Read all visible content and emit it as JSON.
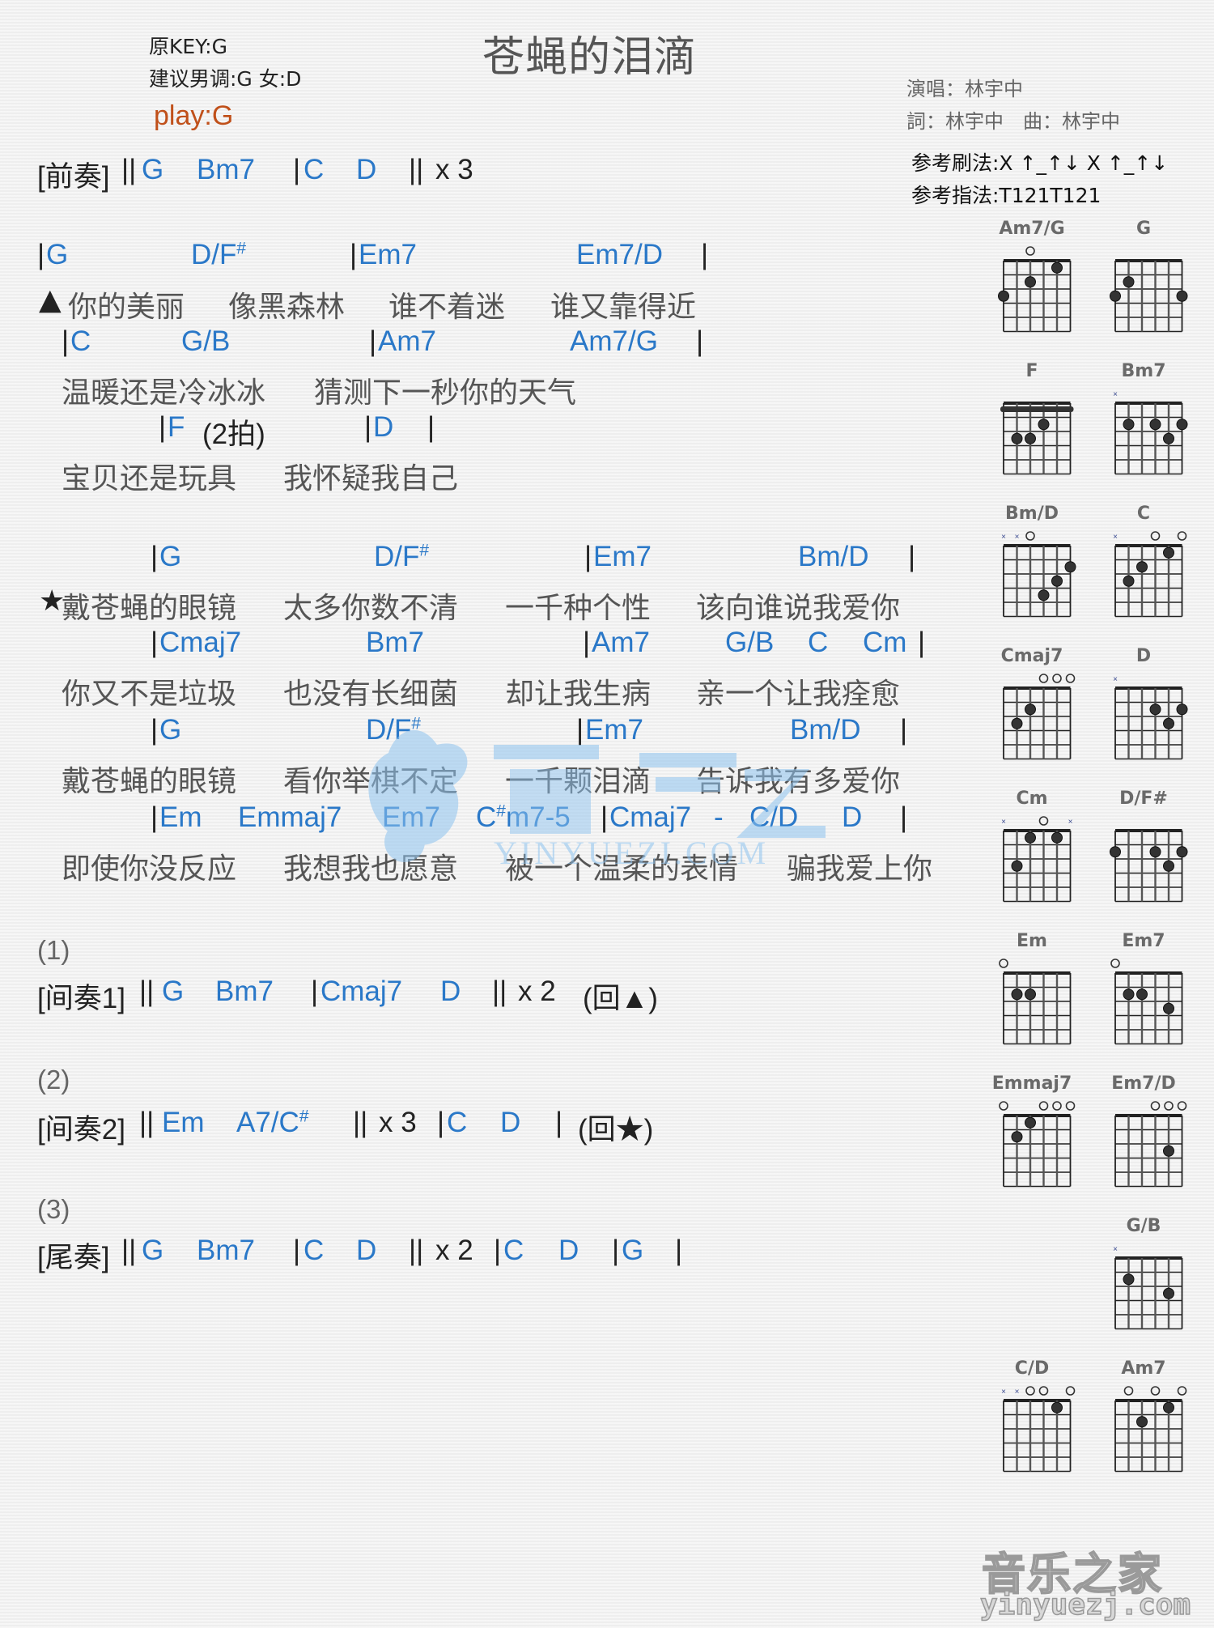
{
  "header": {
    "title": "苍蝇的泪滴",
    "original_key": "原KEY:G",
    "suggested_key": "建议男调:G 女:D",
    "play_key": "play:G",
    "singer": "演唱：林宇中",
    "writers": "詞：林宇中　曲：林宇中",
    "strum_pattern": "参考刷法:X ↑_↑↓ X ↑_↑↓",
    "finger_pattern": "参考指法:T121T121"
  },
  "colors": {
    "chord": "#2a78c8",
    "lyric": "#555555",
    "play_key": "#c0501a",
    "watermark": "#8ec3ef"
  },
  "intro": {
    "label": "[前奏]",
    "tokens": [
      "||",
      "G",
      "Bm7",
      "|",
      "C",
      "D",
      "||",
      "x 3"
    ]
  },
  "verse": [
    {
      "chords": [
        [
          "|",
          "G"
        ],
        [
          "",
          "D/F#"
        ],
        [
          "|",
          "Em7"
        ],
        [
          "",
          "Em7/D"
        ],
        [
          "|",
          ""
        ]
      ],
      "lyric": [
        "▲",
        "你的美丽",
        "像黑森林",
        "谁不着迷",
        "谁又靠得近"
      ]
    },
    {
      "chords": [
        [
          "|",
          "C"
        ],
        [
          "",
          "G/B"
        ],
        [
          "|",
          "Am7"
        ],
        [
          "",
          "Am7/G"
        ],
        [
          "|",
          ""
        ]
      ],
      "lyric": [
        "",
        "温暖还是冷冰冰",
        "猜测下一秒你的天气"
      ]
    },
    {
      "chords": [
        [
          "|",
          "F"
        ],
        [
          "",
          "(2拍)"
        ],
        [
          "|",
          "D"
        ],
        [
          "|",
          ""
        ]
      ],
      "lyric": [
        "",
        "宝贝还是玩具",
        "我怀疑我自己"
      ]
    }
  ],
  "chorus": [
    {
      "chords": [
        [
          "|",
          "G"
        ],
        [
          "",
          "D/F#"
        ],
        [
          "|",
          "Em7"
        ],
        [
          "",
          "Bm/D"
        ],
        [
          "|",
          ""
        ]
      ],
      "lyric": [
        "★",
        "戴苍蝇的眼镜",
        "太多你数不清",
        "一千种个性",
        "该向谁说我爱你"
      ]
    },
    {
      "chords": [
        [
          "|",
          "Cmaj7"
        ],
        [
          "",
          "Bm7"
        ],
        [
          "|",
          "Am7"
        ],
        [
          "",
          "G/B"
        ],
        [
          "",
          "C"
        ],
        [
          "",
          "Cm"
        ],
        [
          "|",
          ""
        ]
      ],
      "lyric": [
        "",
        "你又不是垃圾",
        "也没有长细菌",
        "却让我生病",
        "亲一个让我痊愈"
      ]
    },
    {
      "chords": [
        [
          "|",
          "G"
        ],
        [
          "",
          "D/F#"
        ],
        [
          "|",
          "Em7"
        ],
        [
          "",
          "Bm/D"
        ],
        [
          "|",
          ""
        ]
      ],
      "lyric": [
        "",
        "戴苍蝇的眼镜",
        "看你举棋不定",
        "一千颗泪滴",
        "告诉我有多爱你"
      ]
    },
    {
      "chords": [
        [
          "|",
          "Em"
        ],
        [
          "",
          "Emmaj7"
        ],
        [
          "",
          "Em7"
        ],
        [
          "",
          "C#m7-5"
        ],
        [
          "|",
          "Cmaj7"
        ],
        [
          "",
          "-"
        ],
        [
          "",
          "C/D"
        ],
        [
          "",
          "D"
        ],
        [
          "|",
          ""
        ]
      ],
      "lyric": [
        "",
        "即使你没反应",
        "我想我也愿意",
        "被一个温柔的表情",
        "骗我爱上你"
      ]
    }
  ],
  "interludes": [
    {
      "number": "(1)",
      "label": "[间奏1]",
      "tokens": [
        "||",
        "G",
        "Bm7",
        "|",
        "Cmaj7",
        "D",
        "||",
        "x 2",
        "(回▲)"
      ]
    },
    {
      "number": "(2)",
      "label": "[间奏2]",
      "tokens": [
        "||",
        "Em",
        "A7/C#",
        "||",
        "x 3",
        "|",
        "C",
        "D",
        "|",
        "(回★)"
      ]
    },
    {
      "number": "(3)",
      "label": "[尾奏]",
      "tokens": [
        "||",
        "G",
        "Bm7",
        "|",
        "C",
        "D",
        "||",
        "x 2",
        "|",
        "C",
        "D",
        "|",
        "G",
        "|"
      ]
    }
  ],
  "chord_diagrams": [
    {
      "name": "Am7/G",
      "top": [
        null,
        null,
        0,
        null,
        null,
        null
      ],
      "dots": [
        [
          6,
          3
        ],
        [
          4,
          2
        ],
        [
          2,
          1
        ]
      ],
      "barre": null
    },
    {
      "name": "G",
      "top": [
        null,
        null,
        null,
        null,
        null,
        null
      ],
      "dots": [
        [
          6,
          3
        ],
        [
          5,
          2
        ],
        [
          1,
          3
        ]
      ],
      "barre": null
    },
    {
      "name": "F",
      "top": [
        null,
        null,
        null,
        null,
        null,
        null
      ],
      "dots": [
        [
          5,
          3
        ],
        [
          4,
          3
        ],
        [
          3,
          2
        ]
      ],
      "barre": 1
    },
    {
      "name": "Bm7",
      "top": [
        -1,
        null,
        null,
        null,
        null,
        null
      ],
      "dots": [
        [
          5,
          2
        ],
        [
          3,
          2
        ],
        [
          1,
          2
        ],
        [
          2,
          3
        ]
      ],
      "barre": null
    },
    {
      "name": "Bm/D",
      "top": [
        -1,
        -1,
        0,
        null,
        null,
        null
      ],
      "dots": [
        [
          1,
          2
        ],
        [
          2,
          3
        ],
        [
          3,
          4
        ]
      ],
      "barre": null
    },
    {
      "name": "C",
      "top": [
        -1,
        null,
        null,
        0,
        null,
        0
      ],
      "dots": [
        [
          2,
          1
        ],
        [
          4,
          2
        ],
        [
          5,
          3
        ]
      ],
      "barre": null
    },
    {
      "name": "Cmaj7",
      "top": [
        null,
        null,
        null,
        0,
        0,
        0
      ],
      "dots": [
        [
          4,
          2
        ],
        [
          5,
          3
        ]
      ],
      "barre": null
    },
    {
      "name": "D",
      "top": [
        -1,
        null,
        null,
        null,
        null,
        null
      ],
      "dots": [
        [
          3,
          2
        ],
        [
          1,
          2
        ],
        [
          2,
          3
        ]
      ],
      "barre": null
    },
    {
      "name": "Cm",
      "top": [
        -1,
        null,
        null,
        0,
        null,
        -1
      ],
      "dots": [
        [
          4,
          1
        ],
        [
          2,
          1
        ],
        [
          5,
          3
        ]
      ],
      "barre": null
    },
    {
      "name": "D/F#",
      "top": [
        null,
        null,
        null,
        null,
        null,
        null
      ],
      "dots": [
        [
          6,
          2
        ],
        [
          3,
          2
        ],
        [
          1,
          2
        ],
        [
          2,
          3
        ]
      ],
      "barre": null
    },
    {
      "name": "Em",
      "top": [
        0,
        null,
        null,
        null,
        null,
        null
      ],
      "dots": [
        [
          5,
          2
        ],
        [
          4,
          2
        ]
      ],
      "barre": null
    },
    {
      "name": "Em7",
      "top": [
        0,
        null,
        null,
        null,
        null,
        null
      ],
      "dots": [
        [
          5,
          2
        ],
        [
          4,
          2
        ],
        [
          2,
          3
        ]
      ],
      "barre": null
    },
    {
      "name": "Emmaj7",
      "top": [
        0,
        null,
        null,
        0,
        0,
        0
      ],
      "dots": [
        [
          4,
          1
        ],
        [
          5,
          2
        ]
      ],
      "barre": null
    },
    {
      "name": "Em7/D",
      "top": [
        null,
        null,
        null,
        0,
        0,
        0
      ],
      "dots": [
        [
          2,
          3
        ]
      ],
      "barre": null
    },
    {
      "name": "G/B",
      "top": [
        -1,
        null,
        null,
        null,
        null,
        null
      ],
      "dots": [
        [
          5,
          2
        ],
        [
          2,
          3
        ]
      ],
      "barre": null
    },
    {
      "name": "C/D",
      "top": [
        -1,
        -1,
        0,
        0,
        null,
        0
      ],
      "dots": [
        [
          2,
          1
        ]
      ],
      "barre": null
    },
    {
      "name": "Am7",
      "top": [
        null,
        0,
        null,
        0,
        null,
        0
      ],
      "dots": [
        [
          2,
          1
        ],
        [
          4,
          2
        ]
      ],
      "barre": null
    }
  ],
  "watermark": {
    "brand_cn": "音樂之家",
    "brand_url": "YINYUEZI.COM"
  },
  "footer_logo": {
    "brand_cn": "音乐之家",
    "url": "yinyuezj.com"
  }
}
